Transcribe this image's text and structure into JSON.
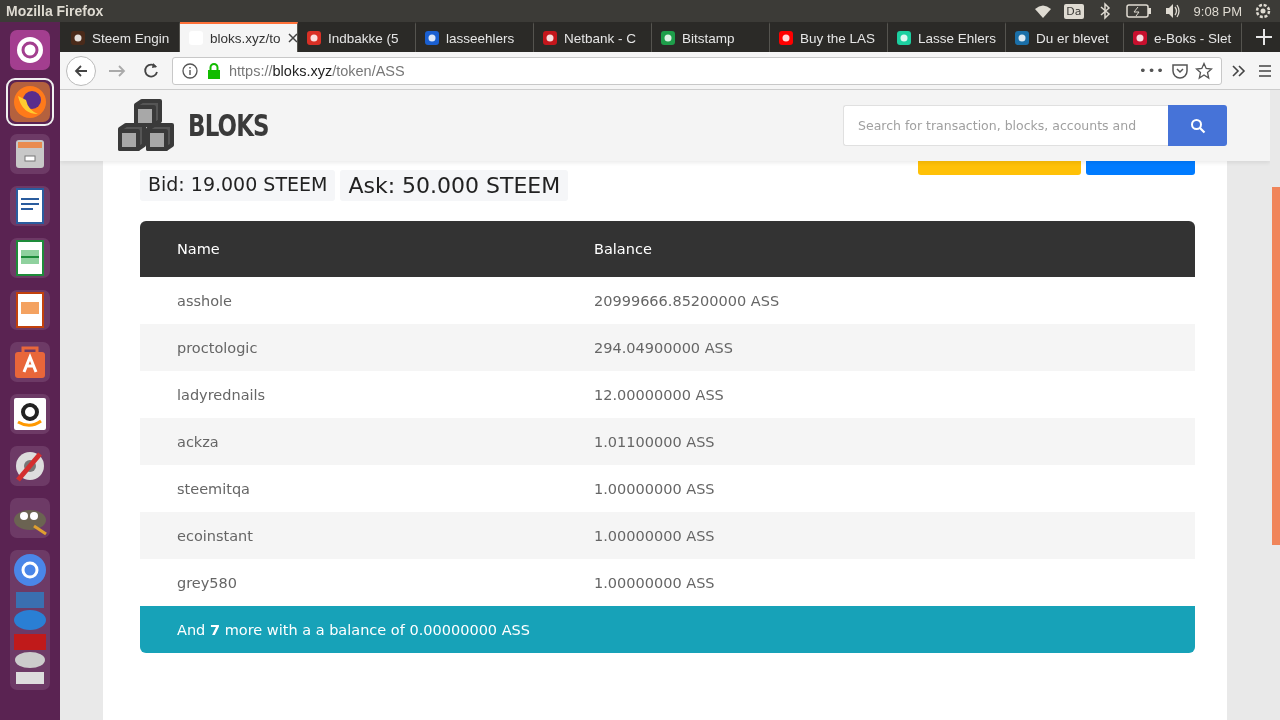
{
  "top_bar": {
    "title": "Mozilla Firefox",
    "keyboard": "Da",
    "clock": "9:08 PM"
  },
  "launcher": {
    "items": [
      {
        "kind": "ubuntu",
        "selected": false
      },
      {
        "kind": "firefox",
        "selected": true
      },
      {
        "kind": "files",
        "selected": false
      },
      {
        "kind": "writer",
        "selected": false
      },
      {
        "kind": "calc",
        "selected": false
      },
      {
        "kind": "impress",
        "selected": false
      },
      {
        "kind": "store",
        "selected": false
      },
      {
        "kind": "amazon",
        "selected": false
      },
      {
        "kind": "settings",
        "selected": false
      },
      {
        "kind": "gimp",
        "selected": false
      },
      {
        "kind": "stack",
        "selected": false
      }
    ]
  },
  "tabs": [
    {
      "label": "Steem Engin",
      "selected": false,
      "color": "#4a2a1a"
    },
    {
      "label": "bloks.xyz/to",
      "selected": true,
      "color": "#ffffff"
    },
    {
      "label": "Indbakke (5",
      "selected": false,
      "color": "#d93025"
    },
    {
      "label": "lasseehlers",
      "selected": false,
      "color": "#1a5fd0"
    },
    {
      "label": "Netbank - C",
      "selected": false,
      "color": "#c4161c"
    },
    {
      "label": "Bitstamp",
      "selected": false,
      "color": "#1e9e4a"
    },
    {
      "label": "Buy the LAS",
      "selected": false,
      "color": "#ff0000"
    },
    {
      "label": "Lasse Ehlers",
      "selected": false,
      "color": "#1ccfa0"
    },
    {
      "label": "Du er blevet",
      "selected": false,
      "color": "#1b6fa8"
    },
    {
      "label": "e-Boks - Slet",
      "selected": false,
      "color": "#c8102e"
    }
  ],
  "url": {
    "scheme": "https://",
    "host": "bloks.xyz",
    "path": "/token/ASS",
    "page_actions": "•••"
  },
  "site": {
    "logo": "BLOKS",
    "search": {
      "placeholder": "Search for transaction, blocks, accounts and"
    }
  },
  "buttons": [
    {
      "kind": "warning"
    },
    {
      "kind": "primary"
    }
  ],
  "quotes": [
    {
      "text": "Bid: 19.000 STEEM",
      "kind": "small"
    },
    {
      "text": "Ask: 50.000 STEEM",
      "kind": "large"
    }
  ],
  "table": {
    "columns": [
      "Name",
      "Balance"
    ],
    "rows": [
      [
        "asshole",
        "20999666.85200000 ASS"
      ],
      [
        "proctologic",
        "294.04900000 ASS"
      ],
      [
        "ladyrednails",
        "12.00000000 ASS"
      ],
      [
        "ackza",
        "1.01100000 ASS"
      ],
      [
        "steemitqa",
        "1.00000000 ASS"
      ],
      [
        "ecoinstant",
        "1.00000000 ASS"
      ],
      [
        "grey580",
        "1.00000000 ASS"
      ]
    ],
    "footer": "And **7** more with a a balance of 0.00000000 ASS"
  }
}
